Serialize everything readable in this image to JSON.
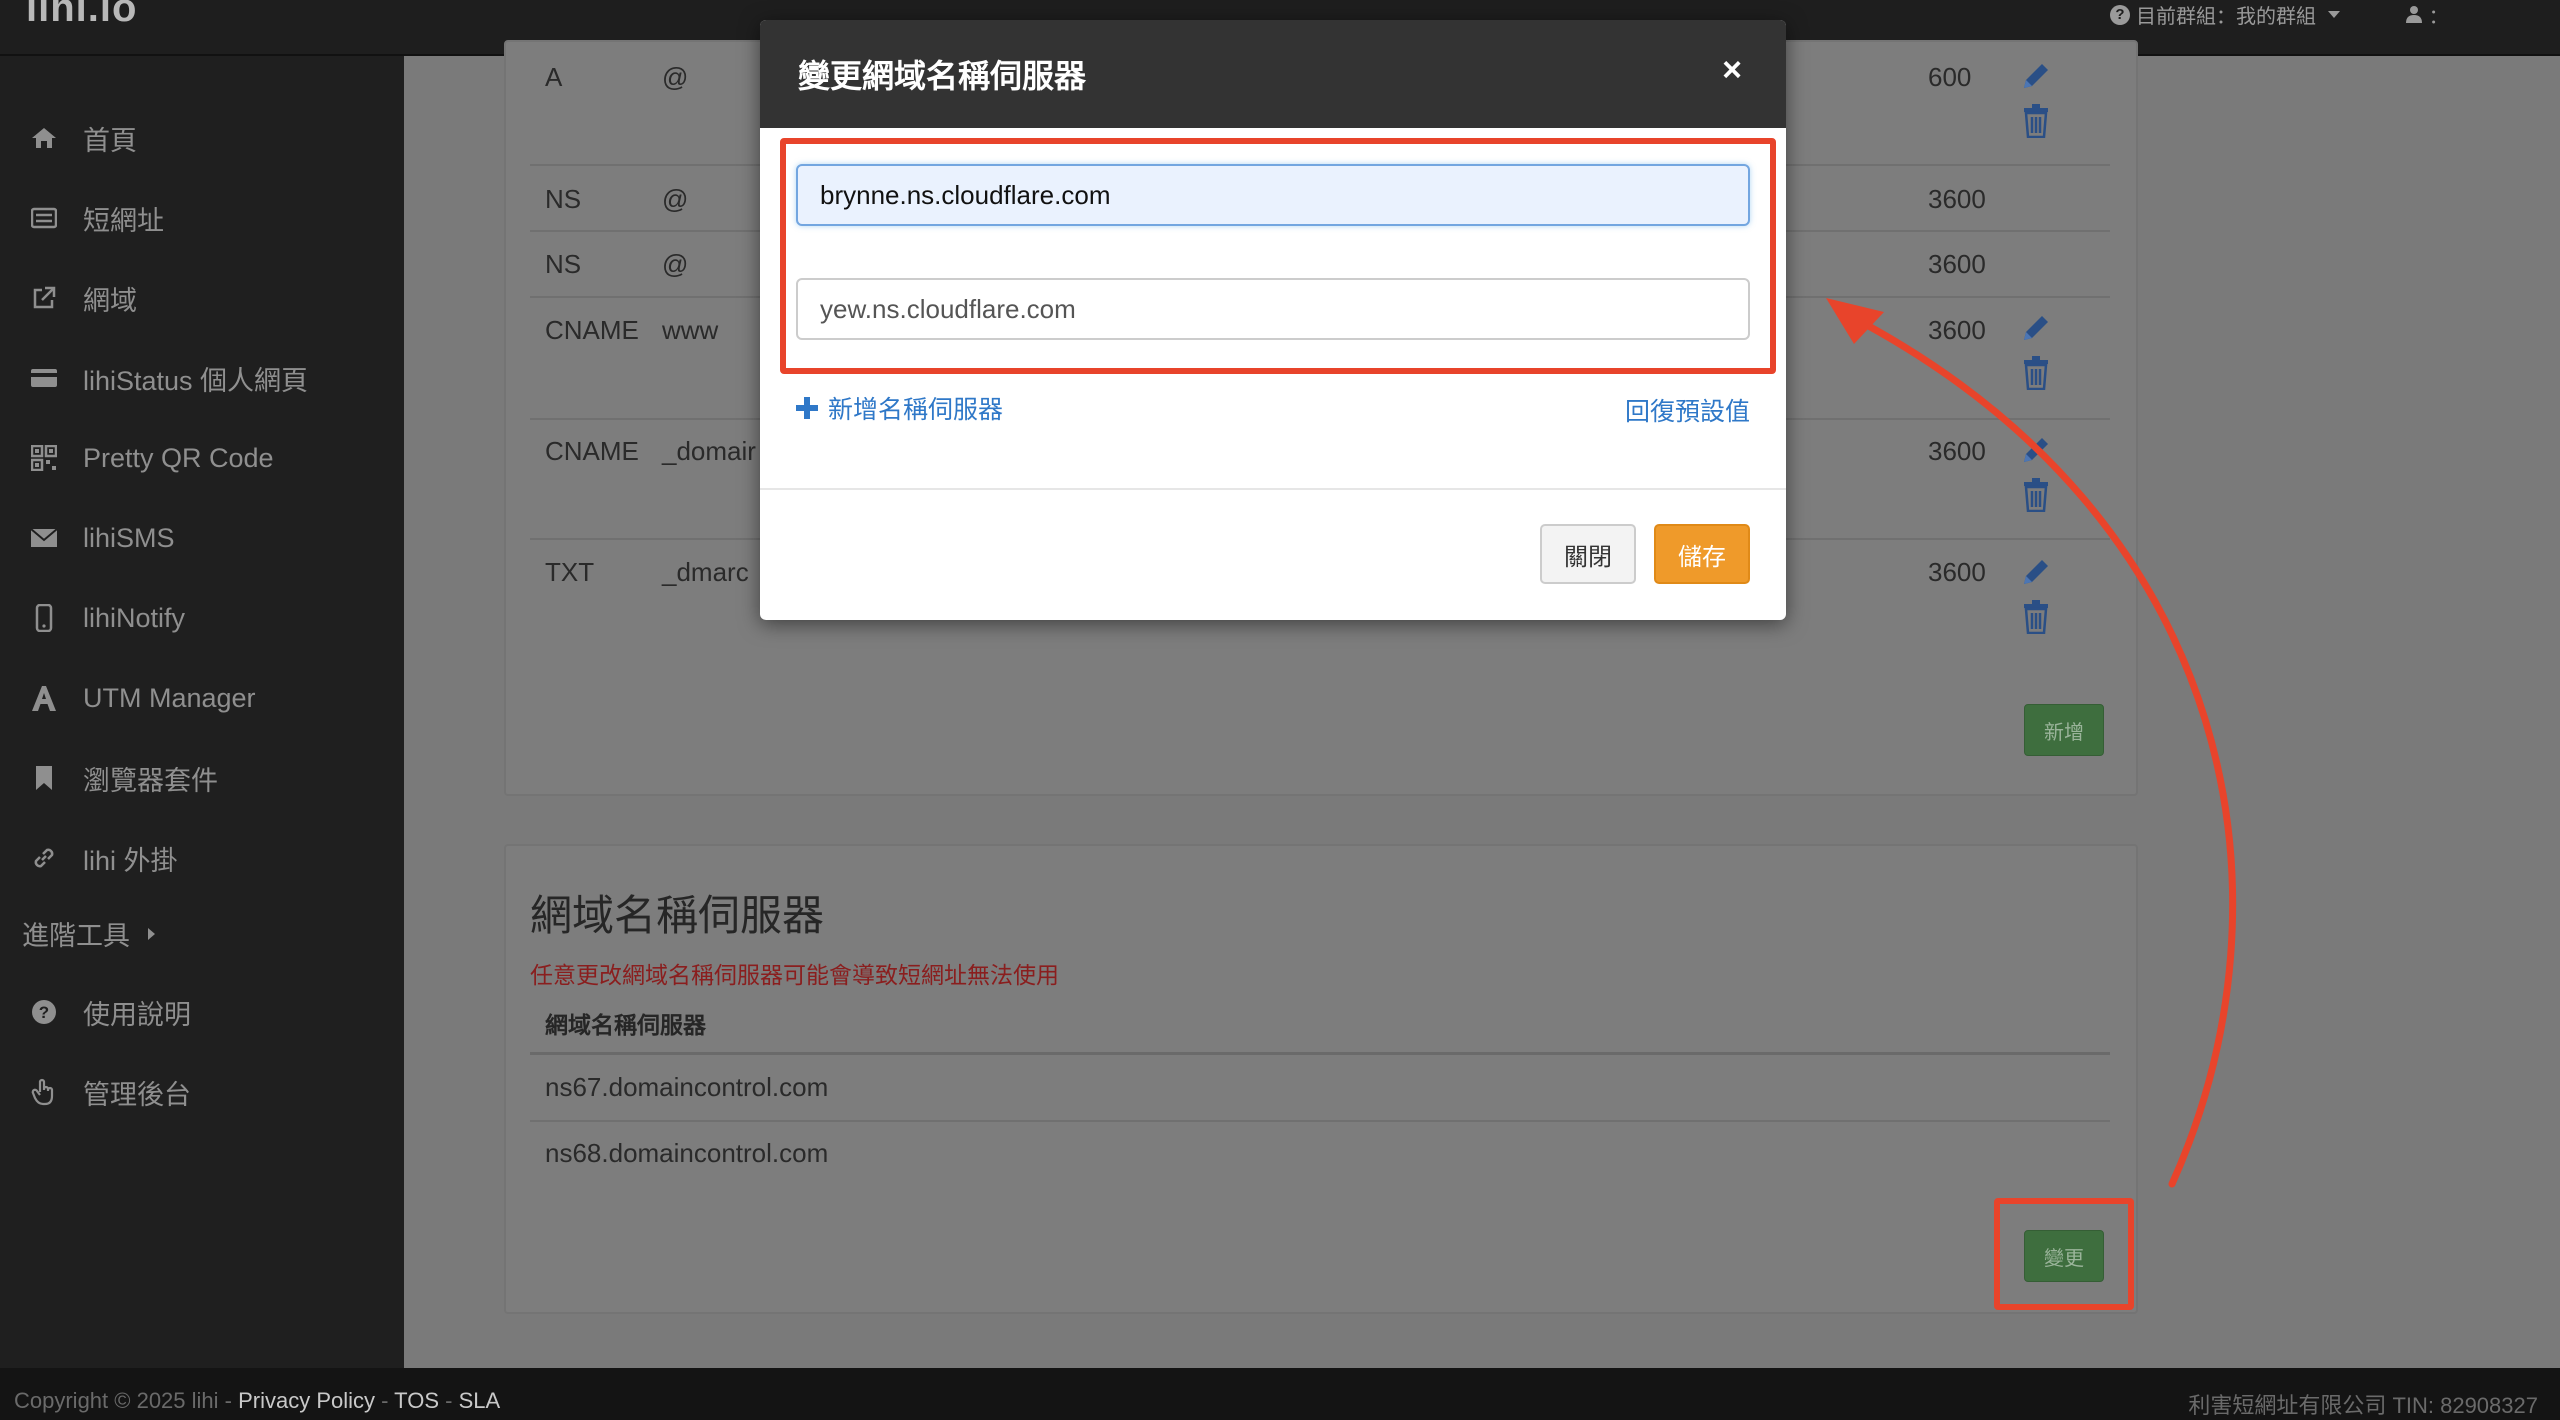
{
  "navbar": {
    "brand": "lihi.io",
    "group_label": "目前群組：我的群組",
    "user_label": "："
  },
  "sidebar": {
    "items": [
      {
        "label": "首頁",
        "icon": "home-icon"
      },
      {
        "label": "短網址",
        "icon": "list-icon"
      },
      {
        "label": "網域",
        "icon": "external-link-icon"
      },
      {
        "label": "lihiStatus 個人網頁",
        "icon": "card-icon"
      },
      {
        "label": "Pretty QR Code",
        "icon": "qrcode-icon"
      },
      {
        "label": "lihiSMS",
        "icon": "envelope-icon"
      },
      {
        "label": "lihiNotify",
        "icon": "mobile-icon"
      },
      {
        "label": "UTM Manager",
        "icon": "font-icon"
      },
      {
        "label": "瀏覽器套件",
        "icon": "bookmark-icon"
      },
      {
        "label": "lihi 外掛",
        "icon": "link-icon"
      }
    ],
    "section_label": "進階工具",
    "bottom_items": [
      {
        "label": "使用說明",
        "icon": "question-circle-icon"
      },
      {
        "label": "管理後台",
        "icon": "hand-pointer-icon"
      }
    ]
  },
  "dns_records": {
    "rows": [
      {
        "type": "A",
        "name": "@",
        "ttl": "600"
      },
      {
        "type": "NS",
        "name": "@",
        "ttl": "3600"
      },
      {
        "type": "NS",
        "name": "@",
        "ttl": "3600"
      },
      {
        "type": "CNAME",
        "name": "www",
        "ttl": "3600"
      },
      {
        "type": "CNAME",
        "name": "_domair",
        "ttl": "3600"
      },
      {
        "type": "TXT",
        "name": "_dmarc",
        "ttl": "3600"
      }
    ],
    "add_button": "新增"
  },
  "nameserver_section": {
    "title": "網域名稱伺服器",
    "warning": "任意更改網域名稱伺服器可能會導致短網址無法使用",
    "column_header": "網域名稱伺服器",
    "servers": [
      "ns67.domaincontrol.com",
      "ns68.domaincontrol.com"
    ],
    "change_button": "變更"
  },
  "footer": {
    "copyright": "Copyright © 2025 lihi - ",
    "privacy": "Privacy Policy",
    "sep1": " - ",
    "tos": "TOS",
    "sep2": " - ",
    "sla": "SLA",
    "company": "利害短網址有限公司 TIN: 82908327"
  },
  "modal": {
    "title": "變更網域名稱伺服器",
    "close_glyph": "×",
    "ns1_value": "brynne.ns.cloudflare.com",
    "ns2_value": "yew.ns.cloudflare.com",
    "add_nameserver": "新增名稱伺服器",
    "restore_default": "回復預設值",
    "close_button": "關閉",
    "save_button": "儲存"
  },
  "colors": {
    "annotation": "#e8442b",
    "save": "#ef9a2a",
    "link": "#2f78c8"
  }
}
